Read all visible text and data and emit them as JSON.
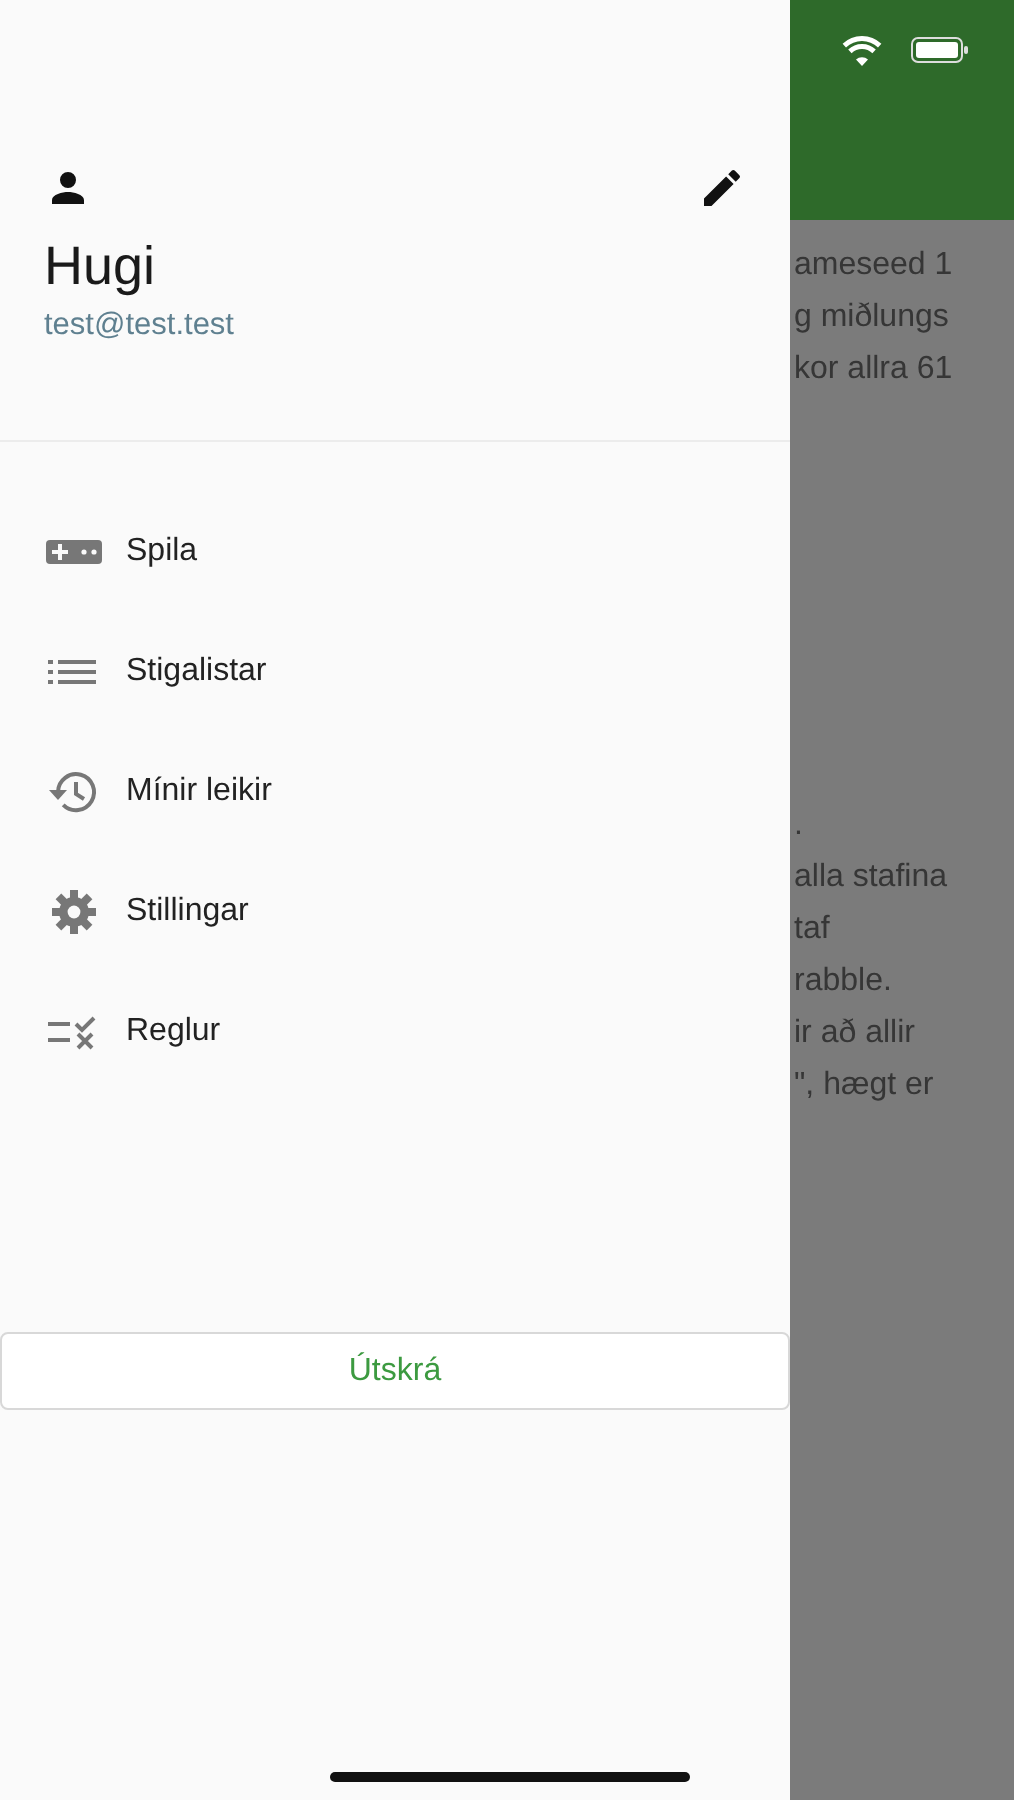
{
  "drawer": {
    "user": {
      "name": "Hugi",
      "email": "test@test.test"
    },
    "menu": [
      {
        "kind": "gamepad",
        "label": "Spila"
      },
      {
        "kind": "list",
        "label": "Stigalistar"
      },
      {
        "kind": "history",
        "label": "Mínir leikir"
      },
      {
        "kind": "gear",
        "label": "Stillingar"
      },
      {
        "kind": "rules",
        "label": "Reglur"
      }
    ],
    "logout_button": "Útskrá"
  },
  "background_page": {
    "blocks": [
      [
        "ameseed 1",
        "g miðlungs",
        "kor allra 61"
      ],
      [
        ".",
        "alla stafina",
        "taf",
        "rabble.",
        "ir að allir",
        "\", hægt er"
      ]
    ]
  }
}
